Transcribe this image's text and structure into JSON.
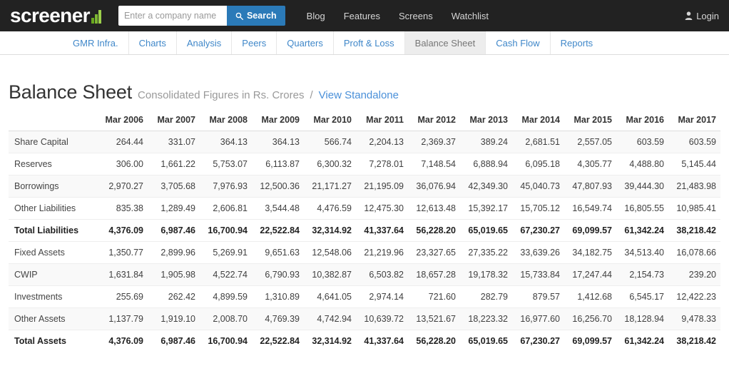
{
  "topbar": {
    "brand": "screener",
    "brand_icon": "bar-chart-icon",
    "search": {
      "placeholder": "Enter a company name",
      "value": "",
      "button_label": "Search",
      "button_icon": "search-icon",
      "button_color": "#2b7ab8"
    },
    "nav": [
      {
        "label": "Blog"
      },
      {
        "label": "Features"
      },
      {
        "label": "Screens"
      },
      {
        "label": "Watchlist"
      }
    ],
    "login": {
      "label": "Login",
      "icon": "user-icon"
    },
    "background": "#222222"
  },
  "tabs": [
    {
      "label": "GMR Infra.",
      "active": false
    },
    {
      "label": "Charts",
      "active": false
    },
    {
      "label": "Analysis",
      "active": false
    },
    {
      "label": "Peers",
      "active": false
    },
    {
      "label": "Quarters",
      "active": false
    },
    {
      "label": "Proft & Loss",
      "active": false
    },
    {
      "label": "Balance Sheet",
      "active": true
    },
    {
      "label": "Cash Flow",
      "active": false
    },
    {
      "label": "Reports",
      "active": false
    }
  ],
  "header": {
    "title": "Balance Sheet",
    "subtitle": "Consolidated Figures in Rs. Crores",
    "separator": "/",
    "link_label": "View Standalone"
  },
  "table": {
    "corner_label": "",
    "columns": [
      "Mar 2006",
      "Mar 2007",
      "Mar 2008",
      "Mar 2009",
      "Mar 2010",
      "Mar 2011",
      "Mar 2012",
      "Mar 2013",
      "Mar 2014",
      "Mar 2015",
      "Mar 2016",
      "Mar 2017"
    ],
    "rows": [
      {
        "label": "Share Capital",
        "total": false,
        "values": [
          "264.44",
          "331.07",
          "364.13",
          "364.13",
          "566.74",
          "2,204.13",
          "2,369.37",
          "389.24",
          "2,681.51",
          "2,557.05",
          "603.59",
          "603.59"
        ]
      },
      {
        "label": "Reserves",
        "total": false,
        "values": [
          "306.00",
          "1,661.22",
          "5,753.07",
          "6,113.87",
          "6,300.32",
          "7,278.01",
          "7,148.54",
          "6,888.94",
          "6,095.18",
          "4,305.77",
          "4,488.80",
          "5,145.44"
        ]
      },
      {
        "label": "Borrowings",
        "total": false,
        "values": [
          "2,970.27",
          "3,705.68",
          "7,976.93",
          "12,500.36",
          "21,171.27",
          "21,195.09",
          "36,076.94",
          "42,349.30",
          "45,040.73",
          "47,807.93",
          "39,444.30",
          "21,483.98"
        ]
      },
      {
        "label": "Other Liabilities",
        "total": false,
        "values": [
          "835.38",
          "1,289.49",
          "2,606.81",
          "3,544.48",
          "4,476.59",
          "12,475.30",
          "12,613.48",
          "15,392.17",
          "15,705.12",
          "16,549.74",
          "16,805.55",
          "10,985.41"
        ]
      },
      {
        "label": "Total Liabilities",
        "total": true,
        "values": [
          "4,376.09",
          "6,987.46",
          "16,700.94",
          "22,522.84",
          "32,314.92",
          "41,337.64",
          "56,228.20",
          "65,019.65",
          "67,230.27",
          "69,099.57",
          "61,342.24",
          "38,218.42"
        ]
      },
      {
        "label": "Fixed Assets",
        "total": false,
        "values": [
          "1,350.77",
          "2,899.96",
          "5,269.91",
          "9,651.63",
          "12,548.06",
          "21,219.96",
          "23,327.65",
          "27,335.22",
          "33,639.26",
          "34,182.75",
          "34,513.40",
          "16,078.66"
        ]
      },
      {
        "label": "CWIP",
        "total": false,
        "values": [
          "1,631.84",
          "1,905.98",
          "4,522.74",
          "6,790.93",
          "10,382.87",
          "6,503.82",
          "18,657.28",
          "19,178.32",
          "15,733.84",
          "17,247.44",
          "2,154.73",
          "239.20"
        ]
      },
      {
        "label": "Investments",
        "total": false,
        "values": [
          "255.69",
          "262.42",
          "4,899.59",
          "1,310.89",
          "4,641.05",
          "2,974.14",
          "721.60",
          "282.79",
          "879.57",
          "1,412.68",
          "6,545.17",
          "12,422.23"
        ]
      },
      {
        "label": "Other Assets",
        "total": false,
        "values": [
          "1,137.79",
          "1,919.10",
          "2,008.70",
          "4,769.39",
          "4,742.94",
          "10,639.72",
          "13,521.67",
          "18,223.32",
          "16,977.60",
          "16,256.70",
          "18,128.94",
          "9,478.33"
        ]
      },
      {
        "label": "Total Assets",
        "total": true,
        "values": [
          "4,376.09",
          "6,987.46",
          "16,700.94",
          "22,522.84",
          "32,314.92",
          "41,337.64",
          "56,228.20",
          "65,019.65",
          "67,230.27",
          "69,099.57",
          "61,342.24",
          "38,218.42"
        ]
      }
    ]
  }
}
